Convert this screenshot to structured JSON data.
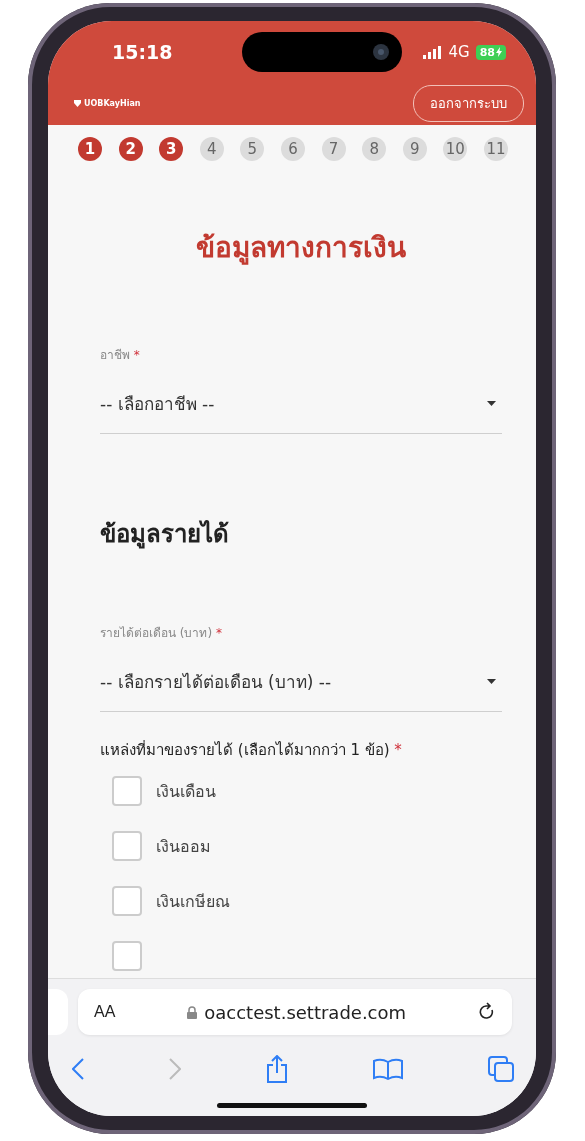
{
  "status_bar": {
    "time": "15:18",
    "network": "4G",
    "battery": "88"
  },
  "header": {
    "logo": "UOBKayHian",
    "logout_button": "ออกจากระบบ"
  },
  "steps": [
    {
      "label": "1",
      "done": true
    },
    {
      "label": "2",
      "done": true
    },
    {
      "label": "3",
      "done": true
    },
    {
      "label": "4",
      "done": false
    },
    {
      "label": "5",
      "done": false
    },
    {
      "label": "6",
      "done": false
    },
    {
      "label": "7",
      "done": false
    },
    {
      "label": "8",
      "done": false
    },
    {
      "label": "9",
      "done": false
    },
    {
      "label": "10",
      "done": false
    },
    {
      "label": "11",
      "done": false
    }
  ],
  "title": "ข้อมูลทางการเงิน",
  "occupation": {
    "label": "อาชีพ",
    "required_mark": "*",
    "placeholder": "-- เลือกอาชีพ --"
  },
  "income_section": {
    "heading": "ข้อมูลรายได้",
    "monthly_income": {
      "label": "รายได้ต่อเดือน (บาท)",
      "required_mark": "*",
      "placeholder": "-- เลือกรายได้ต่อเดือน (บาท) --"
    },
    "sources": {
      "label": "แหล่งที่มาของรายได้ (เลือกได้มากกว่า 1 ข้อ)",
      "required_mark": "*",
      "options": [
        {
          "label": "เงินเดือน",
          "checked": false
        },
        {
          "label": "เงินออม",
          "checked": false
        },
        {
          "label": "เงินเกษียณ",
          "checked": false
        },
        {
          "checked": false
        }
      ]
    }
  },
  "browser": {
    "text_size_button": "AA",
    "url": "oacctest.settrade.com"
  }
}
